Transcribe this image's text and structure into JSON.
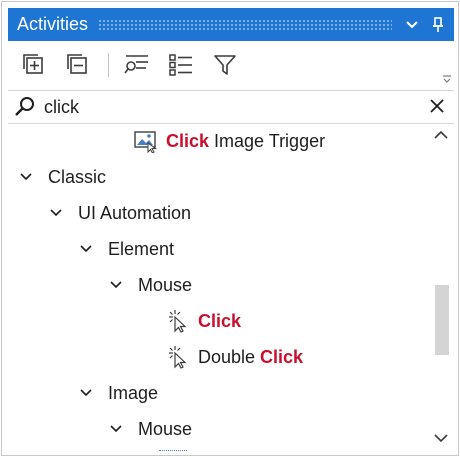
{
  "panel": {
    "title": "Activities"
  },
  "search": {
    "value": "click"
  },
  "tree": {
    "top_item": {
      "highlight": "Click",
      "rest": " Image Trigger"
    },
    "classic": "Classic",
    "ui_automation": "UI Automation",
    "element": "Element",
    "mouse_1": "Mouse",
    "click_item": "Click",
    "double_click": {
      "prefix": "Double ",
      "highlight": "Click"
    },
    "image": "Image",
    "mouse_2": "Mouse"
  },
  "colors": {
    "title_bar": "#1e75d3",
    "highlight": "#c8102e"
  },
  "icons": {
    "toolbar": [
      "expand-all-icon",
      "collapse-all-icon",
      "show-recent-icon",
      "list-view-icon",
      "filter-icon"
    ],
    "activity": [
      "image-trigger-icon",
      "mouse-click-icon"
    ]
  }
}
